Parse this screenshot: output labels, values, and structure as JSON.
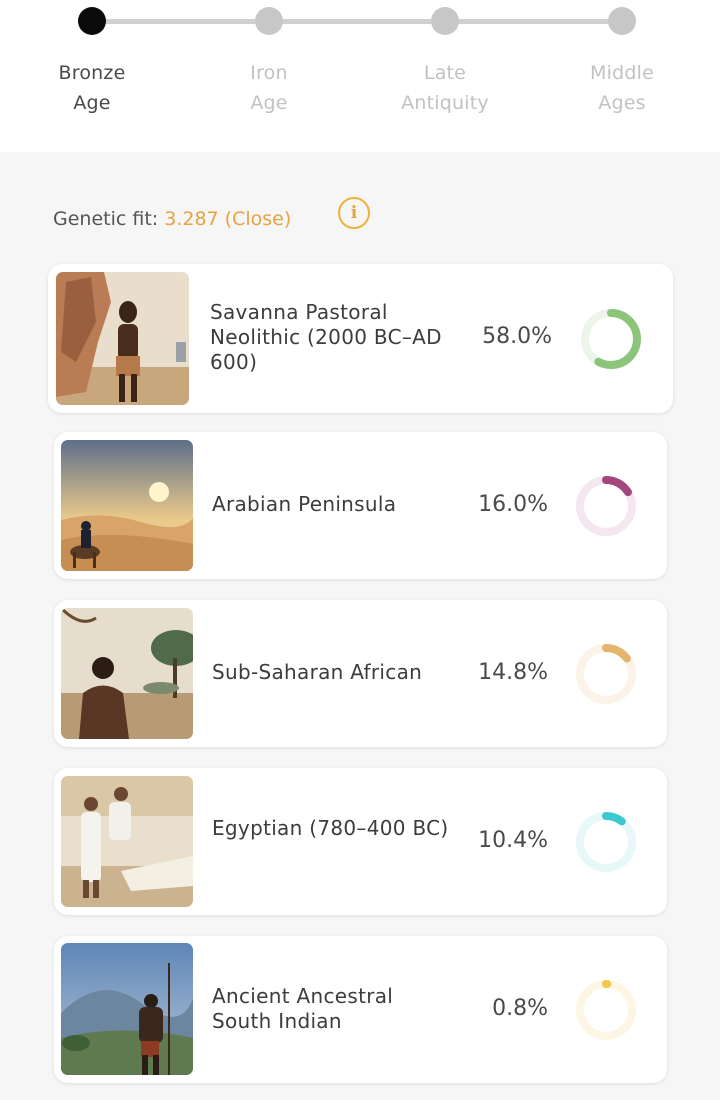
{
  "timeline": {
    "stages": [
      {
        "line1": "Bronze",
        "line2": "Age",
        "active": true
      },
      {
        "line1": "Iron",
        "line2": "Age",
        "active": false
      },
      {
        "line1": "Late",
        "line2": "Antiquity",
        "active": false
      },
      {
        "line1": "Middle",
        "line2": "Ages",
        "active": false
      }
    ]
  },
  "fit": {
    "label": "Genetic fit:",
    "value": "3.287 (Close)",
    "info_icon": "info-icon",
    "accent": "#e7a33e"
  },
  "populations": [
    {
      "name": "Savanna Pastoral Neolithic (2000 BC–AD 600)",
      "percent_text": "58.0%",
      "fraction": 0.58,
      "color": "#8cc47a",
      "track": "#edf5ea"
    },
    {
      "name": "Arabian Peninsula",
      "percent_text": "16.0%",
      "fraction": 0.16,
      "color": "#a2477e",
      "track": "#f5e7f0"
    },
    {
      "name": "Sub-Saharan African",
      "percent_text": "14.8%",
      "fraction": 0.148,
      "color": "#e4b56a",
      "track": "#fcf3e8"
    },
    {
      "name": "Egyptian (780–400 BC)",
      "percent_text": "10.4%",
      "fraction": 0.104,
      "color": "#3cc9cf",
      "track": "#e8f8f8"
    },
    {
      "name": "Ancient Ancestral South Indian",
      "percent_text": "0.8%",
      "fraction": 0.008,
      "color": "#f5c64a",
      "track": "#fdf6e5"
    }
  ]
}
